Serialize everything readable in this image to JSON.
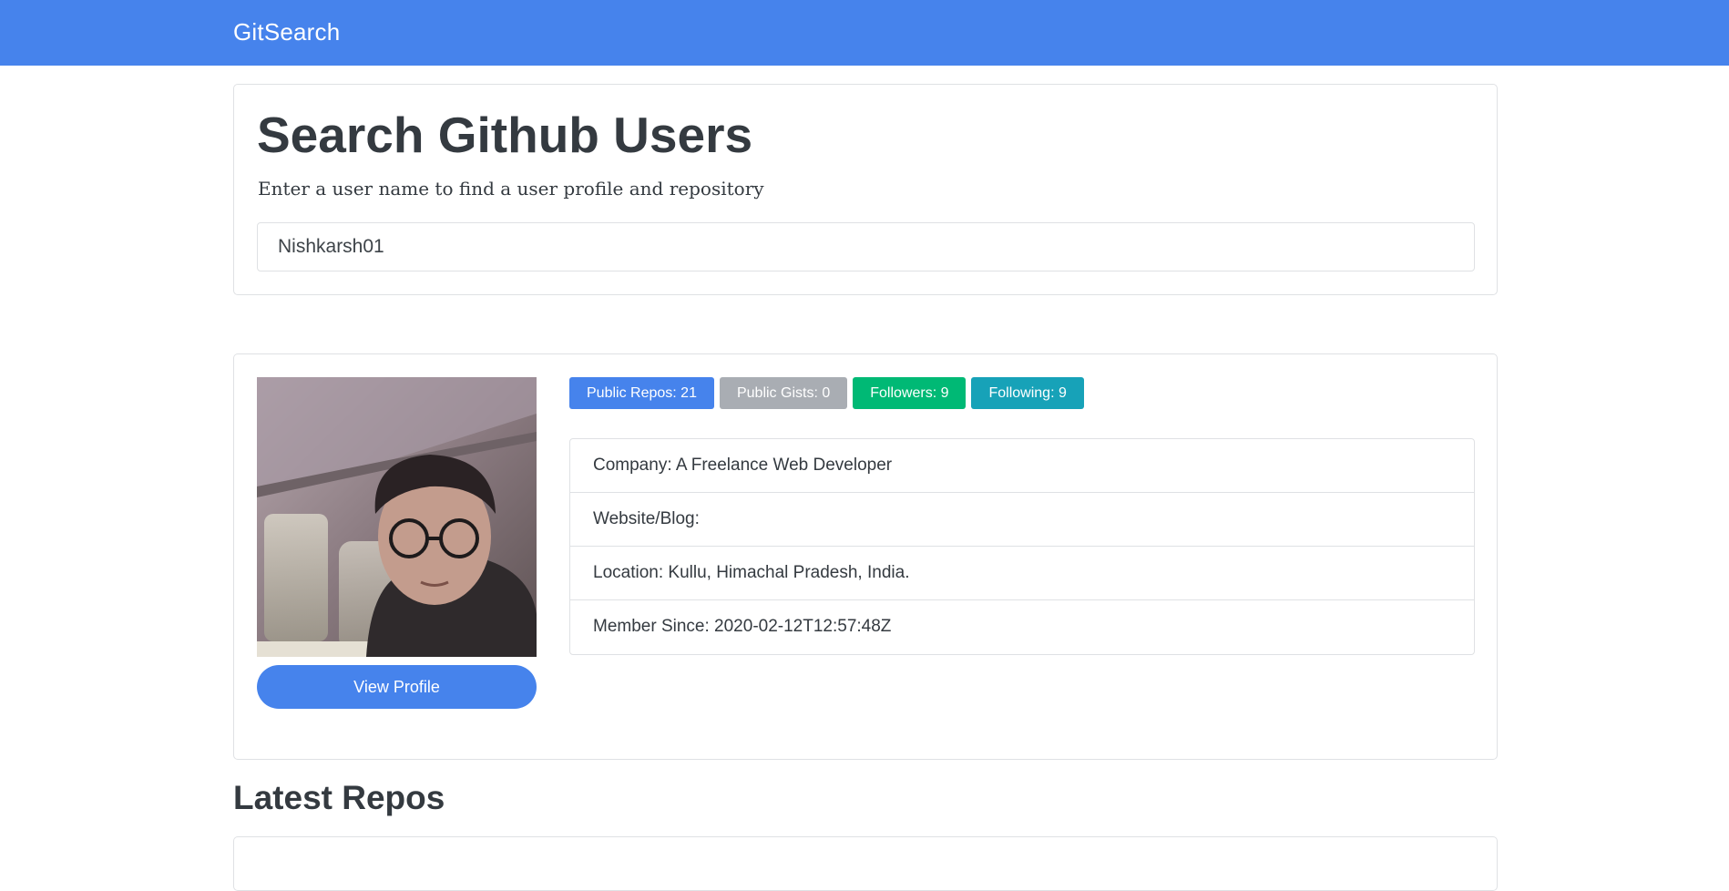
{
  "navbar": {
    "brand": "GitSearch",
    "color": "#4683ec"
  },
  "search": {
    "title": "Search Github Users",
    "subtitle": "Enter a user name to find a user profile and repository",
    "value": "Nishkarsh01"
  },
  "profile": {
    "avatar_icon": "user-avatar-photo",
    "view_profile_label": "View Profile",
    "badges": [
      {
        "label": "Public Repos: 21",
        "color": "#4683ec"
      },
      {
        "label": "Public Gists: 0",
        "color": "#a9adb3"
      },
      {
        "label": "Followers: 9",
        "color": "#00b975"
      },
      {
        "label": "Following: 9",
        "color": "#17a2b8"
      }
    ],
    "info": [
      "Company: A Freelance Web Developer",
      "Website/Blog:",
      "Location: Kullu, Himachal Pradesh, India.",
      "Member Since: 2020-02-12T12:57:48Z"
    ]
  },
  "repos": {
    "title": "Latest Repos"
  }
}
